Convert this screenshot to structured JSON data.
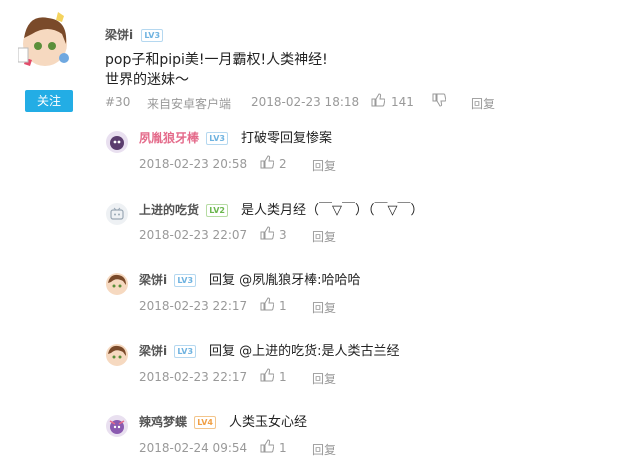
{
  "main": {
    "user": "梁饼i",
    "level": "LV3",
    "follow_label": "关注",
    "text_line1": "pop子和pipi美!一月霸权!人类神经!",
    "text_line2": "世界的迷妹～",
    "floor": "#30",
    "source": "来自安卓客户端",
    "time": "2018-02-23 18:18",
    "likes": "141",
    "reply_label": "回复"
  },
  "replies": [
    {
      "user": "夙胤狼牙棒",
      "level": "LV3",
      "text": "打破零回复惨案",
      "time": "2018-02-23 20:58",
      "likes": "2",
      "reply_label": "回复"
    },
    {
      "user": "上进的吃货",
      "level": "LV2",
      "text": "是人类月经（￣▽￣）（￣▽￣）",
      "time": "2018-02-23 22:07",
      "likes": "3",
      "reply_label": "回复"
    },
    {
      "user": "梁饼i",
      "level": "LV3",
      "text": "回复 @夙胤狼牙棒:哈哈哈",
      "time": "2018-02-23 22:17",
      "likes": "1",
      "reply_label": "回复"
    },
    {
      "user": "梁饼i",
      "level": "LV3",
      "text": "回复 @上进的吃货:是人类古兰经",
      "time": "2018-02-23 22:17",
      "likes": "1",
      "reply_label": "回复"
    },
    {
      "user": "辣鸡梦蝶",
      "level": "LV4",
      "text": "人类玉女心经",
      "time": "2018-02-24 09:54",
      "likes": "1",
      "reply_label": "回复"
    }
  ],
  "colors": {
    "accent": "#23ade5",
    "pink_name": "#e46a8a",
    "meta": "#999999"
  }
}
